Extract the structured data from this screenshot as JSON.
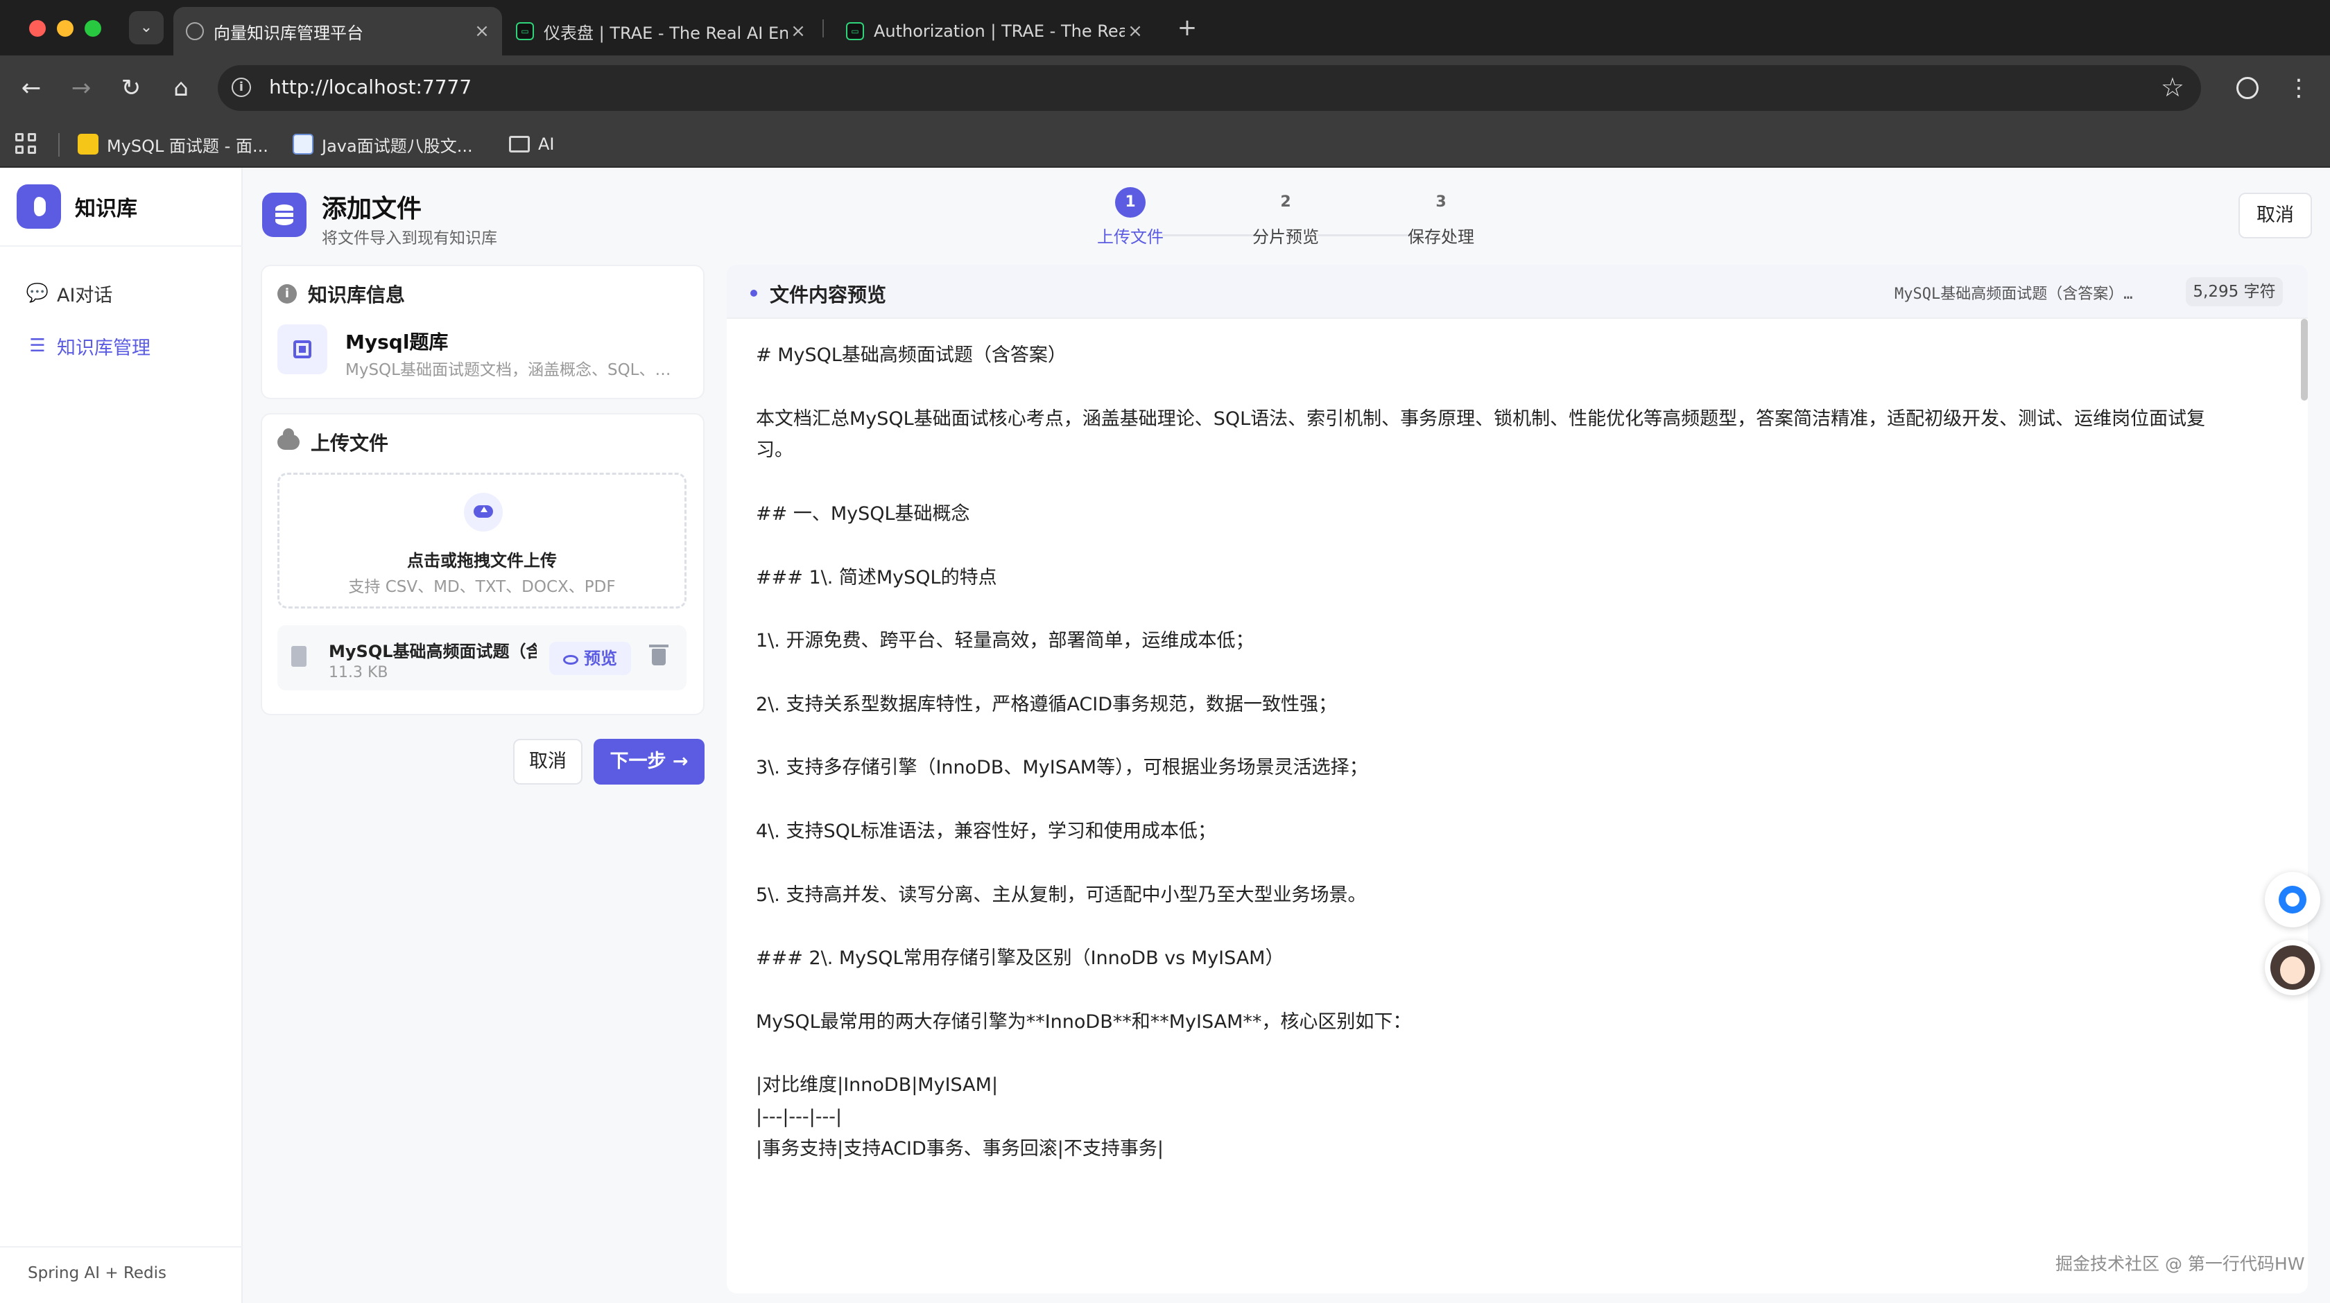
{
  "browser": {
    "tabs": [
      {
        "title": "向量知识库管理平台",
        "active": true,
        "icon": "globe-icon"
      },
      {
        "title": "仪表盘 | TRAE - The Real AI Engineer",
        "active": false,
        "icon": "trae-icon"
      },
      {
        "title": "Authorization | TRAE - The Real AI Engineer",
        "active": false,
        "icon": "trae-icon"
      }
    ],
    "url": "http://localhost:7777",
    "bookmarks": [
      {
        "label": "MySQL 面试题 - 面...",
        "icon": "bookmark-favicon"
      },
      {
        "label": "Java面试题八股文...",
        "icon": "bookmark-favicon"
      },
      {
        "label": "AI",
        "icon": "folder-icon"
      }
    ]
  },
  "sidebar": {
    "brand": "知识库",
    "items": [
      {
        "label": "AI对话",
        "icon": "chat-icon",
        "active": false
      },
      {
        "label": "知识库管理",
        "icon": "list-icon",
        "active": true
      }
    ],
    "footer": "Spring AI + Redis"
  },
  "header": {
    "title": "添加文件",
    "subtitle": "将文件导入到现有知识库",
    "cancel_label": "取消"
  },
  "steps": [
    {
      "number": "1",
      "label": "上传文件",
      "active": true
    },
    {
      "number": "2",
      "label": "分片预览",
      "active": false
    },
    {
      "number": "3",
      "label": "保存处理",
      "active": false
    }
  ],
  "kb_info": {
    "heading": "知识库信息",
    "name": "Mysql题库",
    "description": "MySQL基础面试题文档，涵盖概念、SQL、索引、事务等"
  },
  "upload": {
    "heading": "上传文件",
    "dropzone_title": "点击或拖拽文件上传",
    "dropzone_hint": "支持 CSV、MD、TXT、DOCX、PDF",
    "file": {
      "name": "MySQL基础高频面试题（含答案）.md",
      "size": "11.3 KB",
      "preview_label": "预览"
    }
  },
  "actions": {
    "cancel_label": "取消",
    "next_label": "下一步 →"
  },
  "preview": {
    "title": "文件内容预览",
    "file_name": "MySQL基础高频面试题（含答案）.md",
    "char_count": "5,295 字符",
    "lines": [
      "# MySQL基础高频面试题（含答案）",
      "",
      "本文档汇总MySQL基础面试核心考点，涵盖基础理论、SQL语法、索引机制、事务原理、锁机制、性能优化等高频题型，答案简洁精准，适配初级开发、测试、运维岗位面试复",
      "习。",
      "",
      "## 一、MySQL基础概念",
      "",
      "### 1\\. 简述MySQL的特点",
      "",
      "1\\. 开源免费、跨平台、轻量高效，部署简单，运维成本低；",
      "",
      "2\\. 支持关系型数据库特性，严格遵循ACID事务规范，数据一致性强；",
      "",
      "3\\. 支持多存储引擎（InnoDB、MyISAM等），可根据业务场景灵活选择；",
      "",
      "4\\. 支持SQL标准语法，兼容性好，学习和使用成本低；",
      "",
      "5\\. 支持高并发、读写分离、主从复制，可适配中小型乃至大型业务场景。",
      "",
      "### 2\\. MySQL常用存储引擎及区别（InnoDB vs MyISAM）",
      "",
      "MySQL最常用的两大存储引擎为**InnoDB**和**MyISAM**，核心区别如下：",
      "",
      "|对比维度|InnoDB|MyISAM|",
      "|---|---|---|",
      "|事务支持|支持ACID事务、事务回滚|不支持事务|"
    ]
  },
  "watermark": "掘金技术社区 @ 第一行代码HW",
  "colors": {
    "accent": "#5b5ce2",
    "chrome_dark": "#1f1f1f",
    "chrome_toolbar": "#3c3c3c"
  }
}
